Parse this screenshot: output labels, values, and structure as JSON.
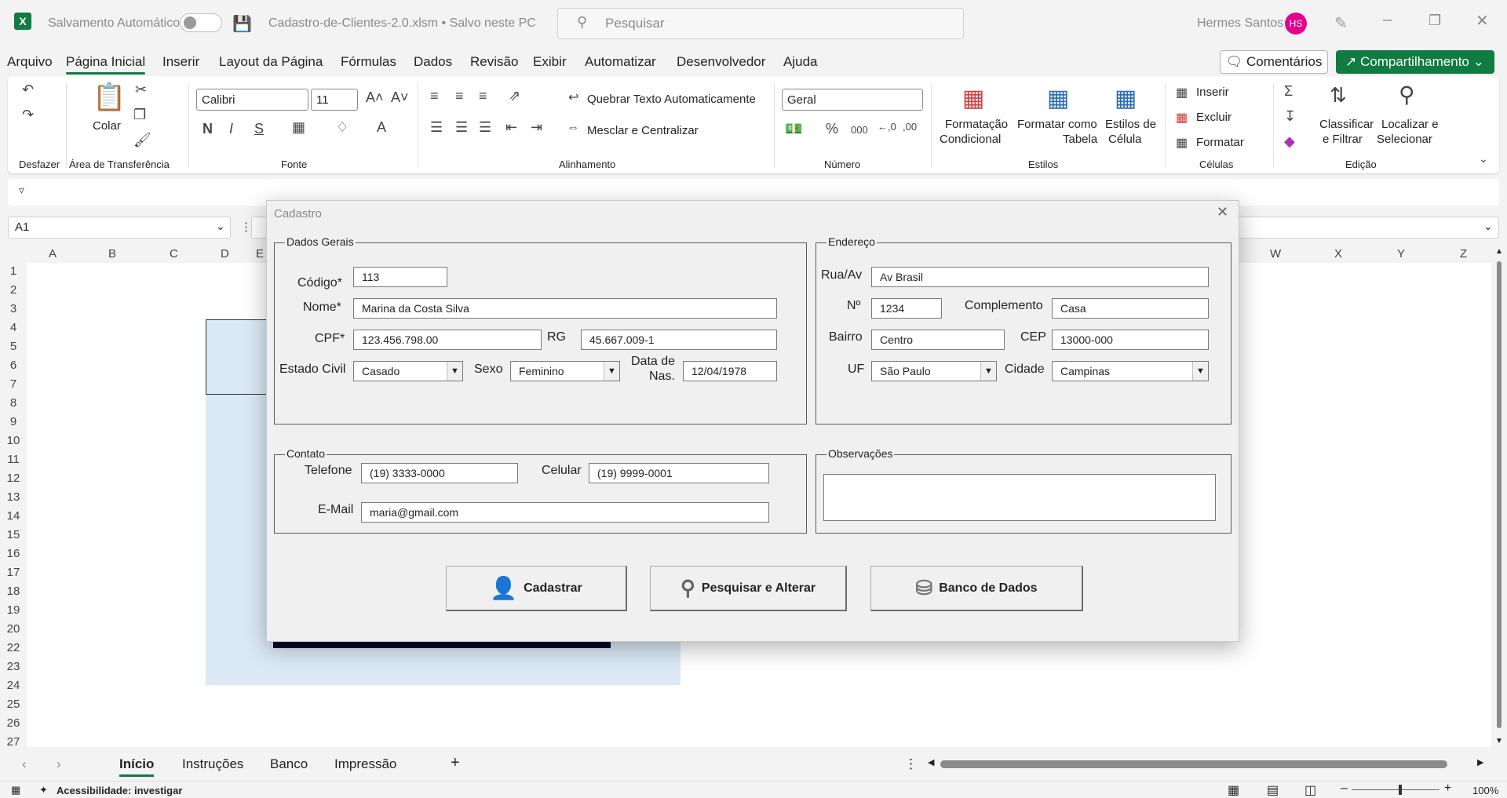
{
  "titlebar": {
    "autosave_label": "Salvamento Automático",
    "filename": "Cadastro-de-Clientes-2.0.xlsm • Salvo neste PC",
    "search_placeholder": "Pesquisar",
    "user_name": "Hermes Santos",
    "user_initials": "HS"
  },
  "menu": {
    "items": [
      "Arquivo",
      "Página Inicial",
      "Inserir",
      "Layout da Página",
      "Fórmulas",
      "Dados",
      "Revisão",
      "Exibir",
      "Automatizar",
      "Desenvolvedor",
      "Ajuda"
    ],
    "comments": "Comentários",
    "share": "Compartilhamento"
  },
  "ribbon": {
    "groups": {
      "undo": "Desfazer",
      "clipboard": "Área de Transferência",
      "font": "Fonte",
      "align": "Alinhamento",
      "number": "Número",
      "styles": "Estilos",
      "cells": "Células",
      "edit": "Edição"
    },
    "paste": "Colar",
    "font_name": "Calibri",
    "font_size": "11",
    "wrap": "Quebrar Texto Automaticamente",
    "merge": "Mesclar e Centralizar",
    "number_format": "Geral",
    "cond_fmt1": "Formatação",
    "cond_fmt2": "Condicional",
    "fmt_table1": "Formatar como",
    "fmt_table2": "Tabela",
    "cell_styles1": "Estilos de",
    "cell_styles2": "Célula",
    "insert": "Inserir",
    "delete": "Excluir",
    "format": "Formatar",
    "sort1": "Classificar",
    "sort2": "e Filtrar",
    "find1": "Localizar e",
    "find2": "Selecionar"
  },
  "namebox": "A1",
  "columns": [
    "A",
    "B",
    "C",
    "D",
    "E",
    "W",
    "X",
    "Y",
    "Z"
  ],
  "rows": [
    "1",
    "2",
    "3",
    "4",
    "5",
    "6",
    "7",
    "8",
    "9",
    "10",
    "11",
    "12",
    "13",
    "14",
    "15",
    "16",
    "17",
    "18",
    "19",
    "20",
    "22",
    "23",
    "24",
    "25",
    "26",
    "27"
  ],
  "sheets": {
    "tabs": [
      "Início",
      "Instruções",
      "Banco",
      "Impressão"
    ],
    "add": "+"
  },
  "status": {
    "accessibility": "Acessibilidade: investigar",
    "zoom": "100%"
  },
  "dialog": {
    "title": "Cadastro",
    "gerais": {
      "legend": "Dados Gerais",
      "codigo_label": "Código*",
      "codigo": "113",
      "nome_label": "Nome*",
      "nome": "Marina da Costa Silva",
      "cpf_label": "CPF*",
      "cpf": "123.456.798.00",
      "rg_label": "RG",
      "rg": "45.667.009-1",
      "estado_label": "Estado Civil",
      "estado": "Casado",
      "sexo_label": "Sexo",
      "sexo": "Feminino",
      "nasc_label1": "Data de",
      "nasc_label2": "Nas.",
      "nasc": "12/04/1978"
    },
    "endereco": {
      "legend": "Endereço",
      "rua_label": "Rua/Av",
      "rua": "Av Brasil",
      "num_label": "Nº",
      "num": "1234",
      "compl_label": "Complemento",
      "compl": "Casa",
      "bairro_label": "Bairro",
      "bairro": "Centro",
      "cep_label": "CEP",
      "cep": "13000-000",
      "uf_label": "UF",
      "uf": "São Paulo",
      "cidade_label": "Cidade",
      "cidade": "Campinas"
    },
    "contato": {
      "legend": "Contato",
      "tel_label": "Telefone",
      "tel": "(19) 3333-0000",
      "cel_label": "Celular",
      "cel": "(19) 9999-0001",
      "email_label": "E-Mail",
      "email": "maria@gmail.com"
    },
    "obs": {
      "legend": "Observações",
      "value": ""
    },
    "buttons": {
      "cadastrar": "Cadastrar",
      "pesquisar": "Pesquisar e Alterar",
      "banco": "Banco de Dados"
    }
  }
}
